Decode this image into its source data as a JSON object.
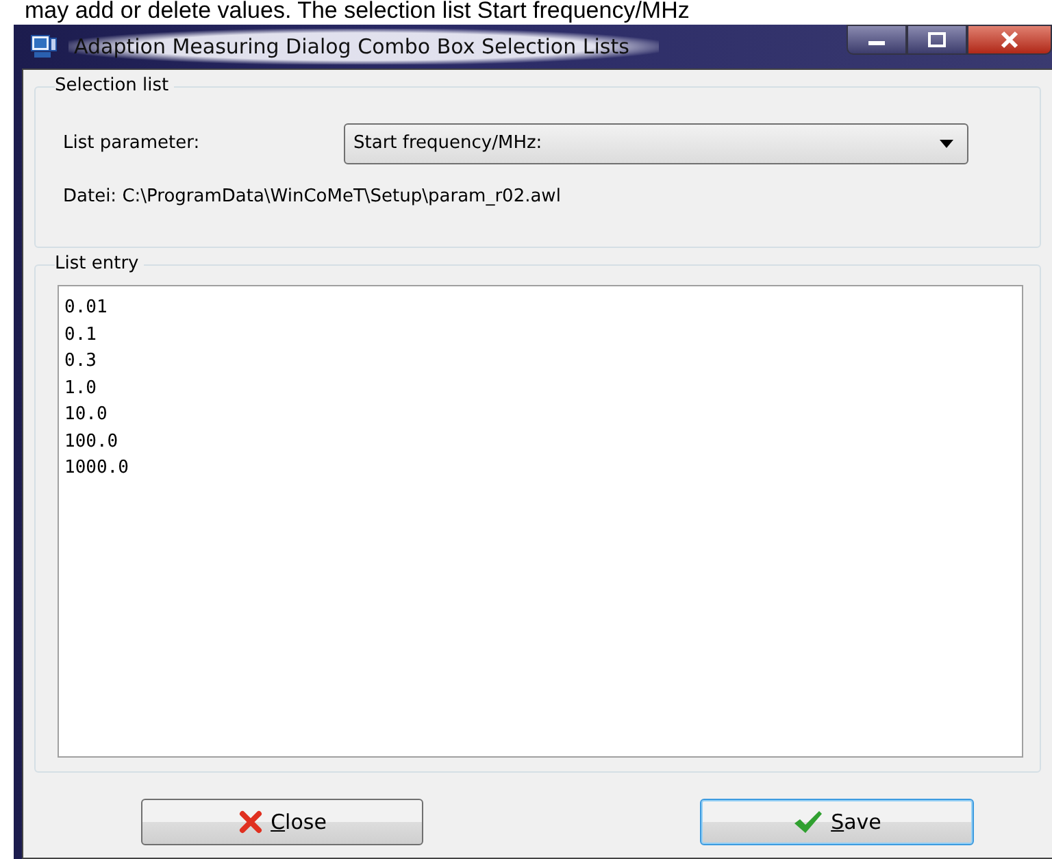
{
  "document_text": "may add or delete values. The selection list Start frequency/MHz",
  "window": {
    "title": "Adaption Measuring Dialog Combo Box Selection Lists"
  },
  "selection_group": {
    "title": "Selection list",
    "label": "List parameter:",
    "combo_value": "Start frequency/MHz:",
    "file_path": "Datei: C:\\ProgramData\\WinCoMeT\\Setup\\param_r02.awl"
  },
  "entry_group": {
    "title": "List entry",
    "lines": [
      "0.01",
      "0.1",
      "0.3",
      "1.0",
      "10.0",
      "100.0",
      "1000.0"
    ]
  },
  "buttons": [
    {
      "kind": "close",
      "underlined": "C",
      "label_rest": "lose",
      "focused": false
    },
    {
      "kind": "save",
      "underlined": "S",
      "label_rest": "ave",
      "focused": true
    }
  ]
}
